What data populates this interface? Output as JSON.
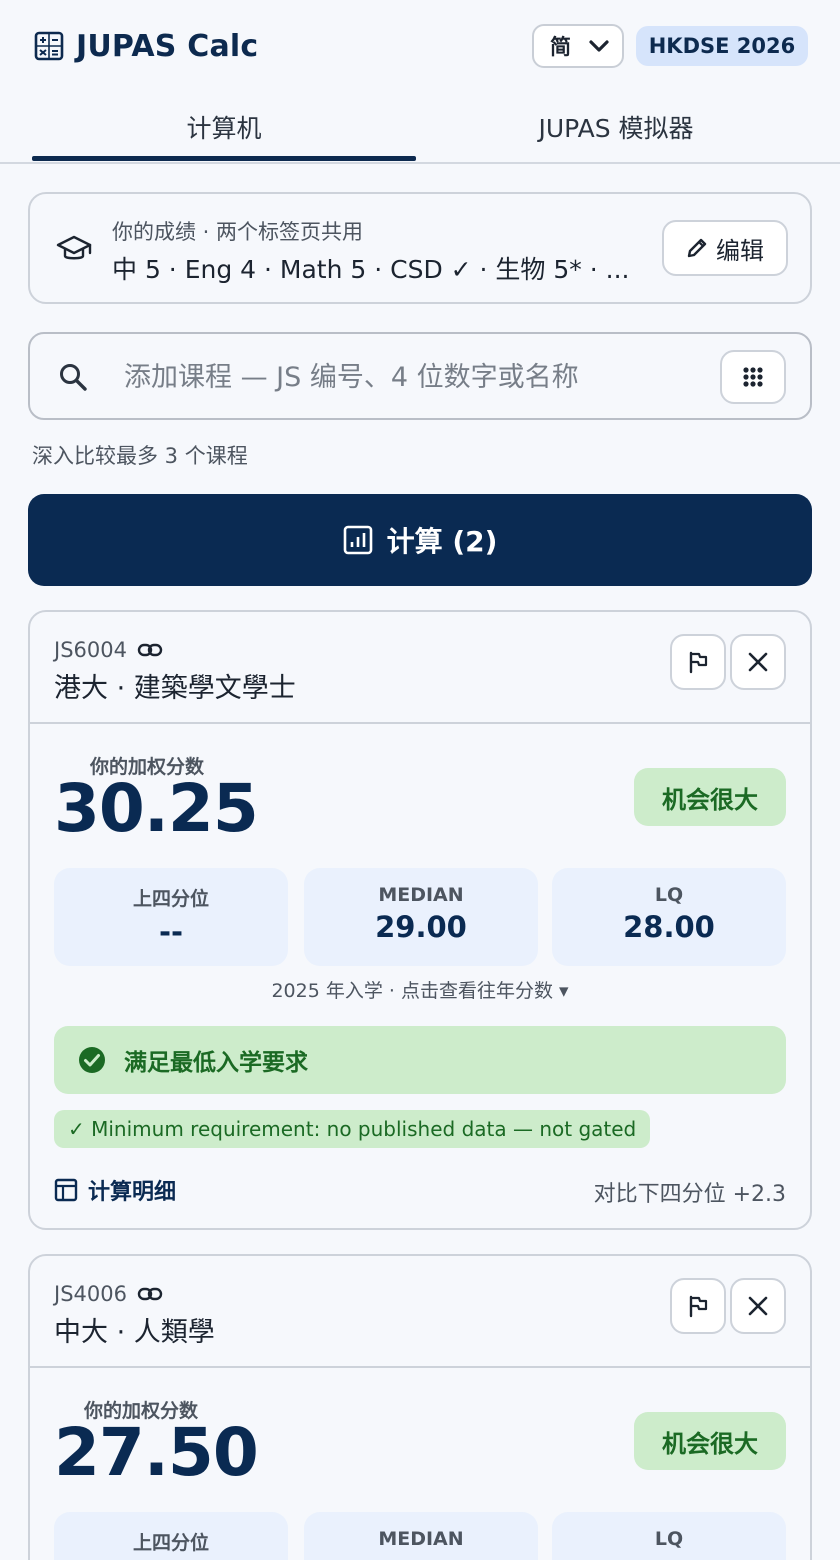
{
  "header": {
    "title": "JUPAS Calc",
    "lang_selected": "简",
    "exam_badge": "HKDSE 2026"
  },
  "tabs": [
    {
      "label": "计算机",
      "active": true
    },
    {
      "label": "JUPAS 模拟器",
      "active": false
    }
  ],
  "scores": {
    "label": "你的成绩 · 两个标签页共用",
    "summary": "中 5 · Eng 4 · Math 5 · CSD ✓ · 生物 5* · ...",
    "edit_label": "编辑"
  },
  "search": {
    "placeholder": "添加课程 — JS 编号、4 位数字或名称",
    "hint": "深入比较最多 3 个课程"
  },
  "calculate_label": "计算 (2)",
  "courses": [
    {
      "code": "JS6004",
      "name": "港大 · 建築學文學士",
      "score_label": "你的加权分数",
      "score": "30.25",
      "chance": "机会很大",
      "stats": [
        {
          "label": "上四分位",
          "value": "--"
        },
        {
          "label": "MEDIAN",
          "value": "29.00"
        },
        {
          "label": "LQ",
          "value": "28.00"
        }
      ],
      "year_note": "2025 年入学 · 点击查看往年分数 ▾",
      "requirement": "满足最低入学要求",
      "requirement_note": "✓ Minimum requirement: no published data — not gated",
      "breakdown_label": "计算明细",
      "vs_lq": "对比下四分位 +2.3"
    },
    {
      "code": "JS4006",
      "name": "中大 · 人類學",
      "score_label": "你的加权分数",
      "score": "27.50",
      "chance": "机会很大",
      "stats": [
        {
          "label": "上四分位",
          "value": ""
        },
        {
          "label": "MEDIAN",
          "value": ""
        },
        {
          "label": "LQ",
          "value": ""
        }
      ]
    }
  ],
  "colors": {
    "primary": "#0a2a52",
    "background": "#f6f8fc",
    "success_bg": "#cdeccb",
    "success_text": "#1b6a24",
    "badge_bg": "#d6e4fb",
    "stat_bg": "#eaf1fd"
  }
}
